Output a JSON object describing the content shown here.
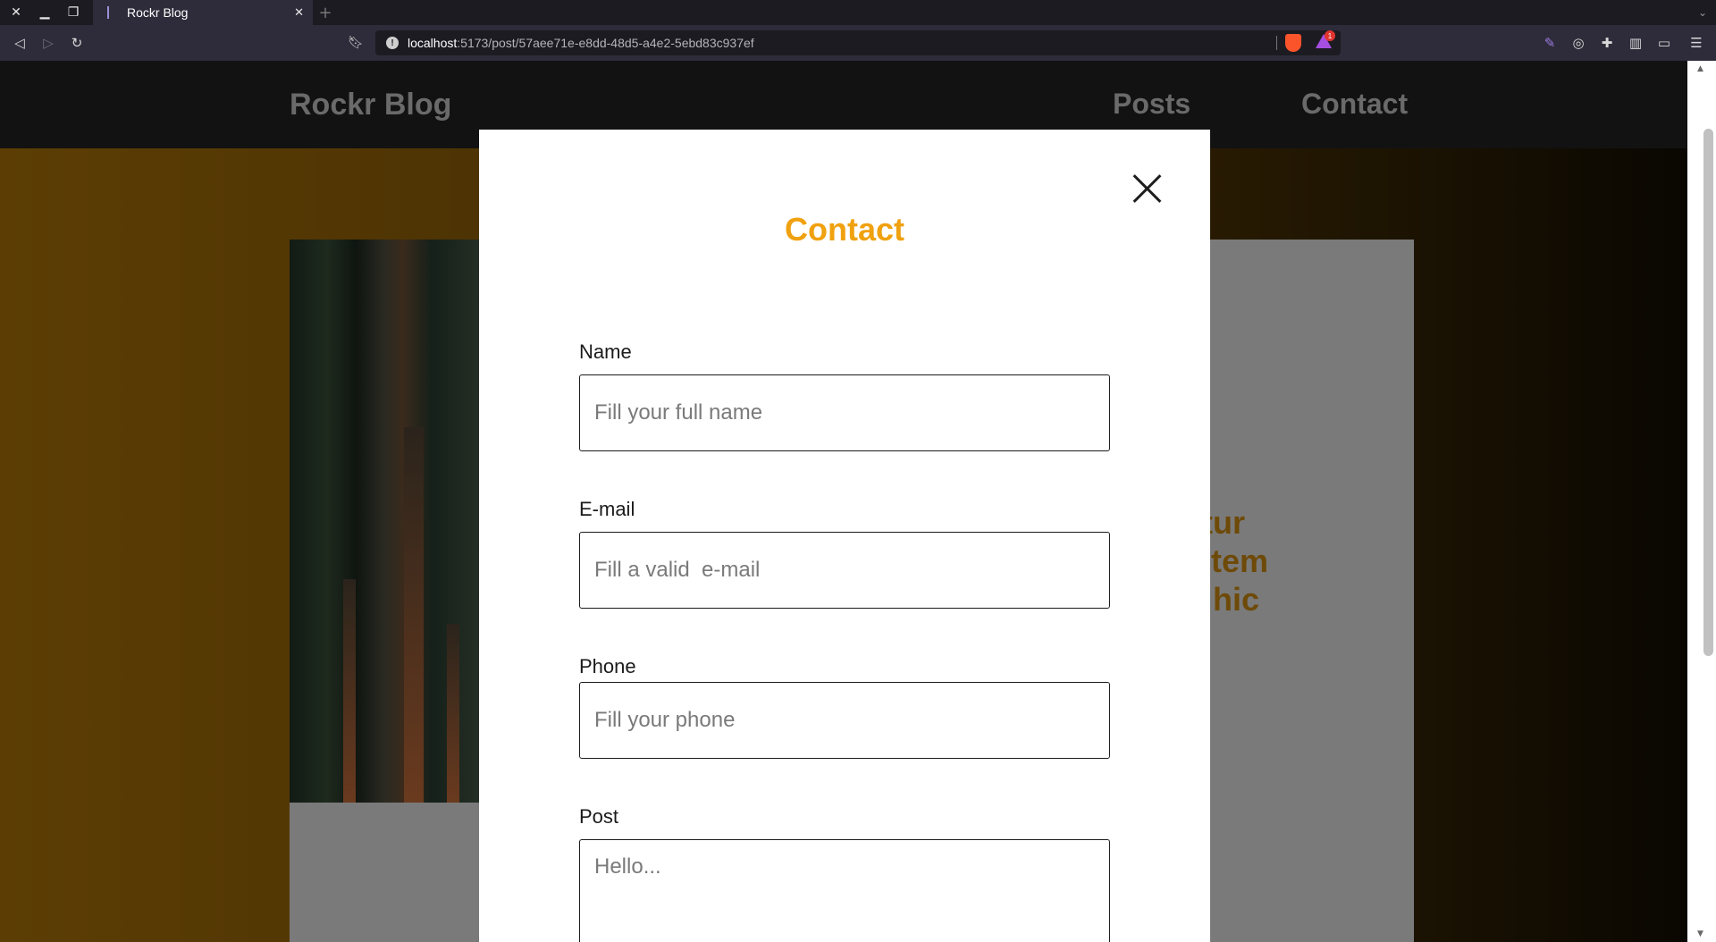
{
  "browser": {
    "tab_title": "Rockr Blog",
    "url_host": "localhost",
    "url_path": ":5173/post/57aee71e-e8dd-48d5-a4e2-5ebd83c937ef",
    "rewards_badge": "1"
  },
  "site": {
    "logo": "Rockr Blog",
    "nav": {
      "posts": "Posts",
      "contact": "Contact"
    },
    "post_title_fragment": [
      "tur",
      "item",
      "hic"
    ]
  },
  "modal": {
    "title": "Contact",
    "fields": {
      "name": {
        "label": "Name",
        "placeholder": "Fill your full name"
      },
      "email": {
        "label": "E-mail",
        "placeholder": "Fill a valid  e-mail"
      },
      "phone": {
        "label": "Phone",
        "placeholder": "Fill your phone"
      },
      "post": {
        "label": "Post",
        "placeholder": "Hello..."
      }
    }
  },
  "colors": {
    "accent": "#f0a10f",
    "header_bg": "#121212",
    "modal_bg": "#ffffff"
  }
}
